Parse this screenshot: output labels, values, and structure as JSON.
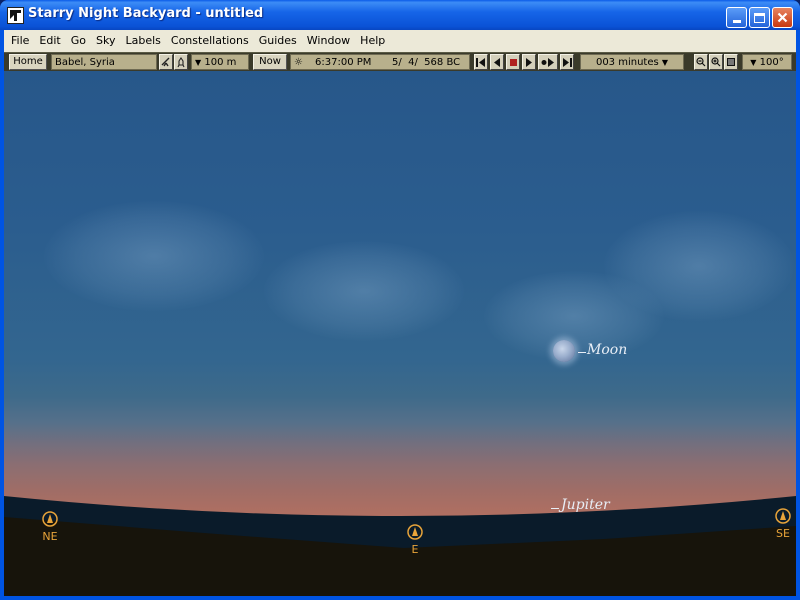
{
  "window": {
    "title": "Starry Night Backyard - untitled"
  },
  "menu": {
    "items": [
      "File",
      "Edit",
      "Go",
      "Sky",
      "Labels",
      "Constellations",
      "Guides",
      "Window",
      "Help"
    ]
  },
  "toolbar": {
    "home_label": "Home",
    "location": "Babel, Syria",
    "elevation": "100 m",
    "now_label": "Now",
    "time": "6:37:00 PM",
    "date": "5/  4/  568 BC",
    "time_step": "003 minutes",
    "fov": "100°"
  },
  "sky": {
    "moon_label": "Moon",
    "jupiter_label": "Jupiter",
    "compass": [
      {
        "label": "NE"
      },
      {
        "label": "E"
      },
      {
        "label": "SE"
      }
    ]
  },
  "colors": {
    "title_bar": "#0a52d6",
    "sky_top": "#27578a",
    "horizon_glow": "#bb7460",
    "compass": "#e8a43a",
    "ground": "#17140b"
  }
}
